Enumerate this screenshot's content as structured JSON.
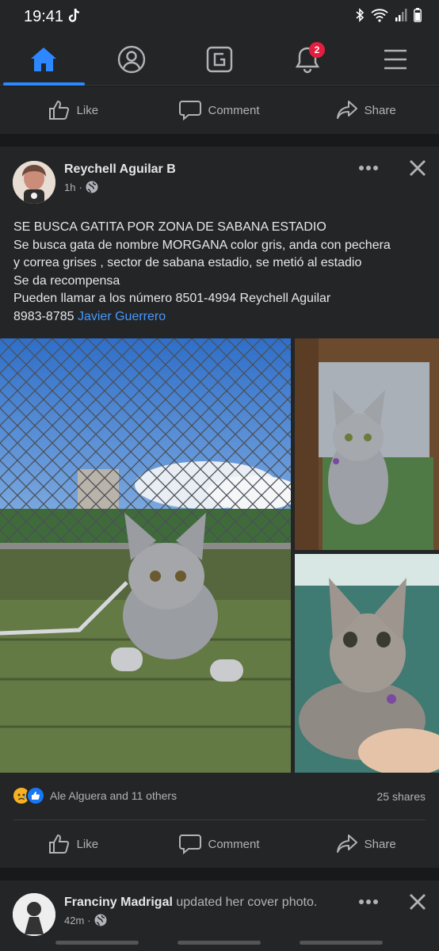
{
  "status_bar": {
    "time": "19:41"
  },
  "nav": {
    "items": [
      "home",
      "profile",
      "marketplace",
      "notifications",
      "menu"
    ],
    "notifications_badge": "2",
    "accent": "#2d88ff"
  },
  "top_actions": {
    "like": "Like",
    "comment": "Comment",
    "share": "Share"
  },
  "post": {
    "author": "Reychell Aguilar B",
    "time": "1h",
    "text_lines": [
      "SE BUSCA GATITA POR ZONA DE SABANA ESTADIO",
      "Se busca gata de nombre MORGANA color gris, anda con pechera",
      "y correa grises , sector de sabana estadio, se metió al estadio",
      "Se da recompensa",
      "Pueden llamar a los número 8501-4994 Reychell Aguilar"
    ],
    "last_line_text": "8983-8785",
    "mention": "Javier Guerrero",
    "reactions_text": "Ale Alguera and 11 others",
    "shares": "25 shares",
    "actions": {
      "like": "Like",
      "comment": "Comment",
      "share": "Share"
    }
  },
  "next_post": {
    "author": "Franciny Madrigal",
    "action_text": "updated her cover photo.",
    "time": "42m"
  }
}
